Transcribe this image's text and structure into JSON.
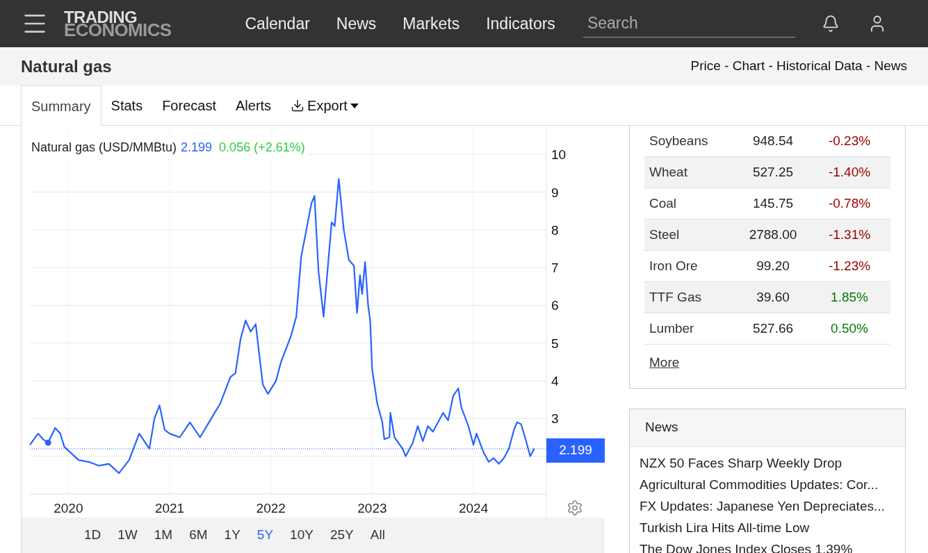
{
  "logo": {
    "line_1": "TRADING",
    "line_2": "ECONOMICS"
  },
  "nav": [
    "Calendar",
    "News",
    "Markets",
    "Indicators"
  ],
  "search": {
    "placeholder": "Search"
  },
  "page": {
    "title": "Natural gas",
    "links": "Price - Chart - Historical Data - News"
  },
  "tabs": [
    {
      "label": "Summary",
      "selected": true
    },
    {
      "label": "Stats",
      "selected": false
    },
    {
      "label": "Forecast",
      "selected": false
    },
    {
      "label": "Alerts",
      "selected": false
    },
    {
      "label": "Export",
      "selected": false,
      "kind": "menu"
    }
  ],
  "chart": {
    "name": "Natural gas (USD/MMBtu)",
    "price": "2.199",
    "change": "0.056 (+2.61%)",
    "last_label": "2.199",
    "chart_data": {
      "type": "line",
      "grid": true,
      "ref_lines": [
        {
          "axis": "y",
          "value": 2.199
        }
      ],
      "xlim": [
        2019.62,
        2024.72
      ],
      "ylim": [
        1,
        10.76
      ],
      "xticks": [
        {
          "value": 2020,
          "label": "2020"
        },
        {
          "value": 2021,
          "label": "2021"
        },
        {
          "value": 2022,
          "label": "2022"
        },
        {
          "value": 2023,
          "label": "2023"
        },
        {
          "value": 2024,
          "label": "2024"
        }
      ],
      "yticks": [
        3,
        4,
        5,
        6,
        7,
        8,
        9,
        10
      ],
      "x": [
        2019.62,
        2019.7,
        2019.75,
        2019.8,
        2019.87,
        2019.92,
        2019.96,
        2020.0,
        2020.1,
        2020.2,
        2020.3,
        2020.4,
        2020.5,
        2020.6,
        2020.7,
        2020.8,
        2020.85,
        2020.9,
        2020.95,
        2021.0,
        2021.1,
        2021.2,
        2021.3,
        2021.4,
        2021.5,
        2021.55,
        2021.6,
        2021.65,
        2021.7,
        2021.75,
        2021.8,
        2021.85,
        2021.88,
        2021.92,
        2021.97,
        2022.05,
        2022.1,
        2022.2,
        2022.25,
        2022.3,
        2022.35,
        2022.4,
        2022.43,
        2022.47,
        2022.52,
        2022.6,
        2022.63,
        2022.67,
        2022.72,
        2022.77,
        2022.82,
        2022.85,
        2022.88,
        2022.9,
        2022.93,
        2022.96,
        2022.98,
        2023.0,
        2023.05,
        2023.1,
        2023.12,
        2023.17,
        2023.18,
        2023.22,
        2023.3,
        2023.33,
        2023.4,
        2023.45,
        2023.5,
        2023.55,
        2023.6,
        2023.7,
        2023.75,
        2023.8,
        2023.85,
        2023.88,
        2023.95,
        2024.0,
        2024.03,
        2024.1,
        2024.15,
        2024.2,
        2024.25,
        2024.3,
        2024.35,
        2024.4,
        2024.43,
        2024.47,
        2024.52,
        2024.56,
        2024.6
      ],
      "series": [
        {
          "color": "#2962ff",
          "values": [
            2.3,
            2.6,
            2.45,
            2.36,
            2.75,
            2.6,
            2.25,
            2.15,
            1.9,
            1.85,
            1.75,
            1.8,
            1.55,
            1.9,
            2.6,
            2.2,
            3.0,
            3.35,
            2.7,
            2.6,
            2.5,
            2.9,
            2.5,
            2.95,
            3.4,
            3.75,
            4.1,
            4.2,
            5.1,
            5.6,
            5.3,
            5.5,
            4.8,
            3.9,
            3.65,
            4.0,
            4.5,
            5.2,
            5.7,
            7.3,
            8.0,
            8.7,
            8.9,
            6.9,
            5.7,
            8.2,
            8.1,
            9.35,
            8.0,
            7.2,
            7.05,
            5.8,
            6.8,
            6.3,
            7.15,
            6.0,
            5.6,
            4.3,
            3.4,
            2.9,
            2.45,
            2.5,
            3.15,
            2.5,
            2.2,
            2.0,
            2.35,
            2.8,
            2.4,
            2.8,
            2.65,
            3.15,
            2.95,
            3.6,
            3.8,
            3.3,
            2.8,
            2.3,
            2.6,
            2.1,
            1.85,
            1.95,
            1.8,
            1.95,
            2.2,
            2.7,
            2.9,
            2.85,
            2.4,
            2.0,
            2.2
          ]
        }
      ]
    }
  },
  "ranges": [
    {
      "label": "1D",
      "selected": false
    },
    {
      "label": "1W",
      "selected": false
    },
    {
      "label": "1M",
      "selected": false
    },
    {
      "label": "6M",
      "selected": false
    },
    {
      "label": "1Y",
      "selected": false
    },
    {
      "label": "5Y",
      "selected": true
    },
    {
      "label": "10Y",
      "selected": false
    },
    {
      "label": "25Y",
      "selected": false
    },
    {
      "label": "All",
      "selected": false
    }
  ],
  "commodities": [
    {
      "name": "Soybeans",
      "price": "948.54",
      "change": "-0.23%",
      "color": "#a00000"
    },
    {
      "name": "Wheat",
      "price": "527.25",
      "change": "-1.40%",
      "color": "#a00000"
    },
    {
      "name": "Coal",
      "price": "145.75",
      "change": "-0.78%",
      "color": "#a00000"
    },
    {
      "name": "Steel",
      "price": "2788.00",
      "change": "-1.31%",
      "color": "#a00000"
    },
    {
      "name": "Iron Ore",
      "price": "99.20",
      "change": "-1.23%",
      "color": "#a00000"
    },
    {
      "name": "TTF Gas",
      "price": "39.60",
      "change": "1.85%",
      "color": "#007a00"
    },
    {
      "name": "Lumber",
      "price": "527.66",
      "change": "0.50%",
      "color": "#007a00"
    }
  ],
  "more_link": "More",
  "news": {
    "title": "News",
    "items": [
      "NZX 50 Faces Sharp Weekly Drop",
      "Agricultural Commodities Updates: Cor...",
      "FX Updates: Japanese Yen Depreciates...",
      "Turkish Lira Hits All-time Low",
      "The Dow Jones Index Closes 1.39%"
    ]
  }
}
